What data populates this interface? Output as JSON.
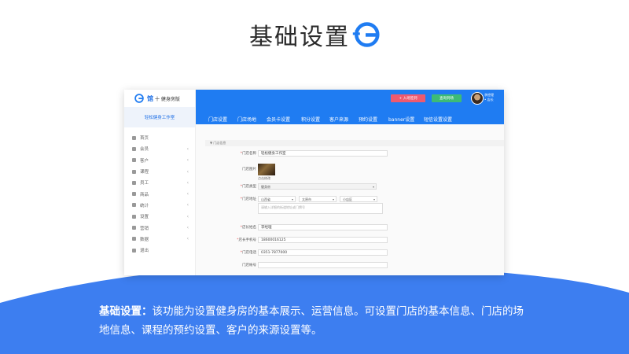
{
  "slide": {
    "title": "基础设置",
    "caption_head": "基础设置：",
    "caption_line1": "该功能为设置健身房的基本展示、运营信息。可设置门店的基本信息、门店的场",
    "caption_line2": "地信息、课程的预约设置、客户的来源设置等。",
    "brand_color": "#1f7cf2"
  },
  "app": {
    "logo_text": "馆",
    "logo_sub": "十 健身房版",
    "studio_name": "轻松健身工作室",
    "nav": [
      {
        "label": "首页",
        "icon": "home-icon",
        "chevron": ""
      },
      {
        "label": "会员",
        "icon": "members-icon",
        "chevron": "‹"
      },
      {
        "label": "客户",
        "icon": "user-add-icon",
        "chevron": "‹"
      },
      {
        "label": "课程",
        "icon": "course-icon",
        "chevron": "‹"
      },
      {
        "label": "员工",
        "icon": "staff-icon",
        "chevron": "‹"
      },
      {
        "label": "商品",
        "icon": "goods-icon",
        "chevron": "‹"
      },
      {
        "label": "统计",
        "icon": "stats-icon",
        "chevron": "‹"
      },
      {
        "label": "设置",
        "icon": "gear-icon",
        "chevron": "‹"
      },
      {
        "label": "营销",
        "icon": "marketing-icon",
        "chevron": "‹"
      },
      {
        "label": "数据",
        "icon": "data-icon",
        "chevron": "‹"
      },
      {
        "label": "退出",
        "icon": "logout-icon",
        "chevron": ""
      }
    ],
    "header": {
      "checkin_button": "+ 入场签到",
      "query_button": "查询到场",
      "user_name": "李经理",
      "user_role": "• 店长"
    },
    "tabs": [
      "门店设置",
      "门店场地",
      "会员卡设置",
      "积分设置",
      "客户来源",
      "预约设置",
      "banner设置",
      "短信设置设置"
    ],
    "section_title": "▼ 门店信息",
    "form": {
      "store_name_label": "门店名称",
      "store_name_value": "轻松健身工作室",
      "store_image_label": "门店图片",
      "store_image_hint": "点击修改",
      "store_type_label": "门店类型",
      "store_type_value": "健身房",
      "address_label": "门店地址",
      "province": "山西省",
      "city": "太原市",
      "district": "小店区",
      "address_placeholder": "请输入详细的街道地址或门牌号",
      "manager_label": "店长姓名",
      "manager_value": "李经理",
      "manager_phone_label": "店长手机号",
      "manager_phone_value": "18600016125",
      "store_phone_label": "门店电话",
      "store_phone_value": "0351-7877000",
      "store_account_label": "门店帐号",
      "store_account_value": ""
    }
  }
}
